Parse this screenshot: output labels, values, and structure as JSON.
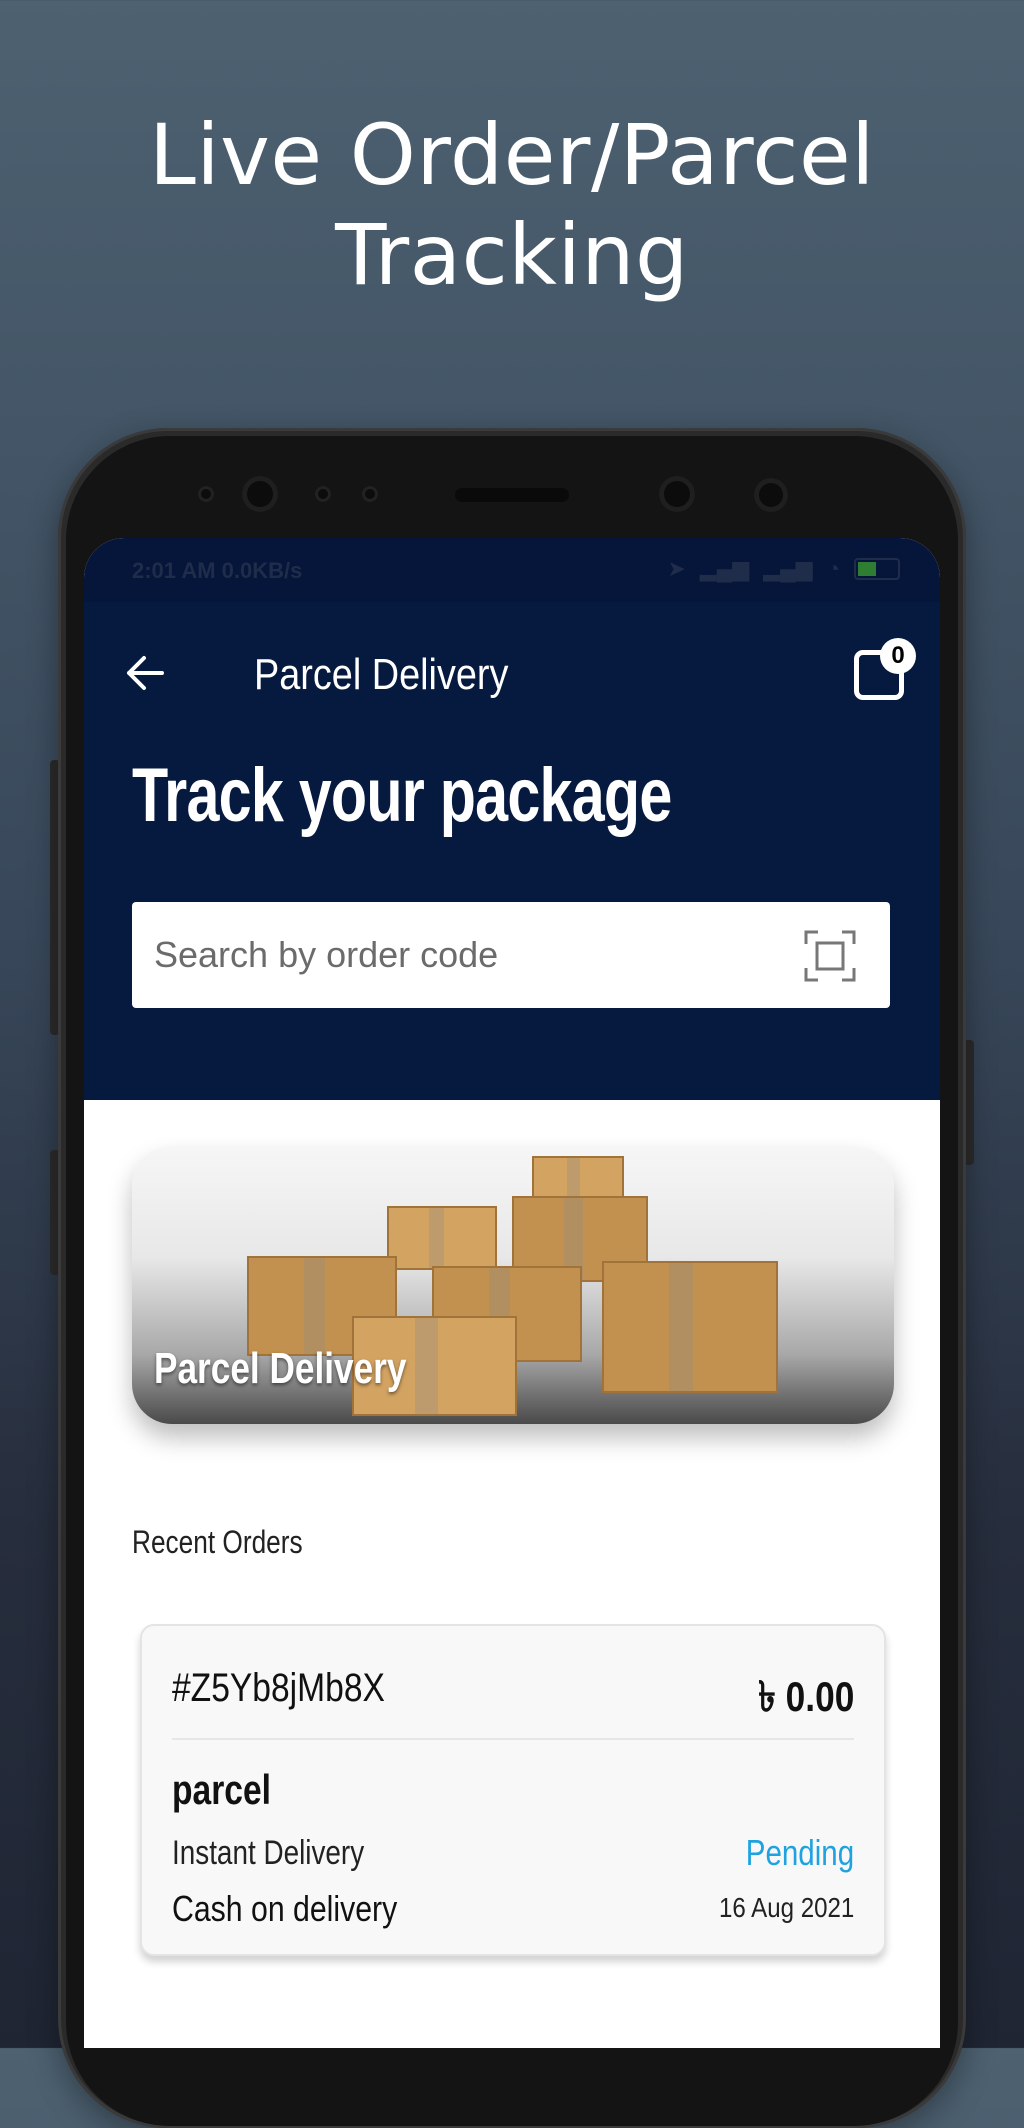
{
  "headline": {
    "line1": "Live Order/Parcel",
    "line2": "Tracking"
  },
  "statusbar": {
    "time": "2:01 AM",
    "speed": "0.0KB/s"
  },
  "appbar": {
    "title": "Parcel Delivery",
    "cart_count": "0",
    "icons": [
      "arrow-left-icon",
      "shopping-bag-icon"
    ]
  },
  "hero": {
    "title": "Track your package"
  },
  "search": {
    "placeholder": "Search by order code",
    "icon": "scan-icon"
  },
  "banner": {
    "label": "Parcel Delivery"
  },
  "recent_orders": {
    "title": "Recent Orders",
    "orders": [
      {
        "id": "#Z5Yb8jMb8X",
        "price": "৳ 0.00",
        "type": "parcel",
        "delivery": "Instant Delivery",
        "status": "Pending",
        "payment": "Cash on delivery",
        "date": "16 Aug 2021"
      }
    ]
  },
  "colors": {
    "appbar_bg": "#06193f",
    "status_pending": "#1fa2e0",
    "background_top": "#4d6171",
    "background_bottom": "#1f2533"
  }
}
